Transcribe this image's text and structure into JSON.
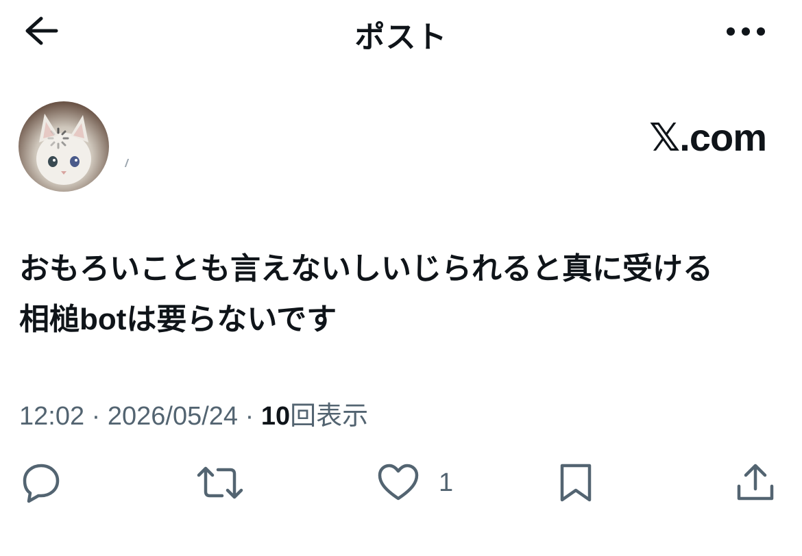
{
  "header": {
    "title": "ポスト",
    "back_icon": "arrow-left-icon",
    "more_icon": "more-horizontal-icon"
  },
  "author": {
    "avatar_icon": "cat-avatar",
    "brand": "𝕏.com"
  },
  "post": {
    "line1": "おもろいことも言えないしいじられると真に受ける",
    "line2": "相槌botは要らないです"
  },
  "meta": {
    "time": "12:02",
    "sep1": " · ",
    "date": "2026/05/24",
    "sep2": " · ",
    "views_count": "10",
    "views_label": "回表示"
  },
  "actions": {
    "reply_icon": "reply-bubble-icon",
    "repost_icon": "repost-icon",
    "like_icon": "heart-icon",
    "like_count": "1",
    "bookmark_icon": "bookmark-icon",
    "share_icon": "share-icon"
  },
  "colors": {
    "text_primary": "#0f1419",
    "text_secondary": "#536471",
    "background": "#ffffff"
  }
}
